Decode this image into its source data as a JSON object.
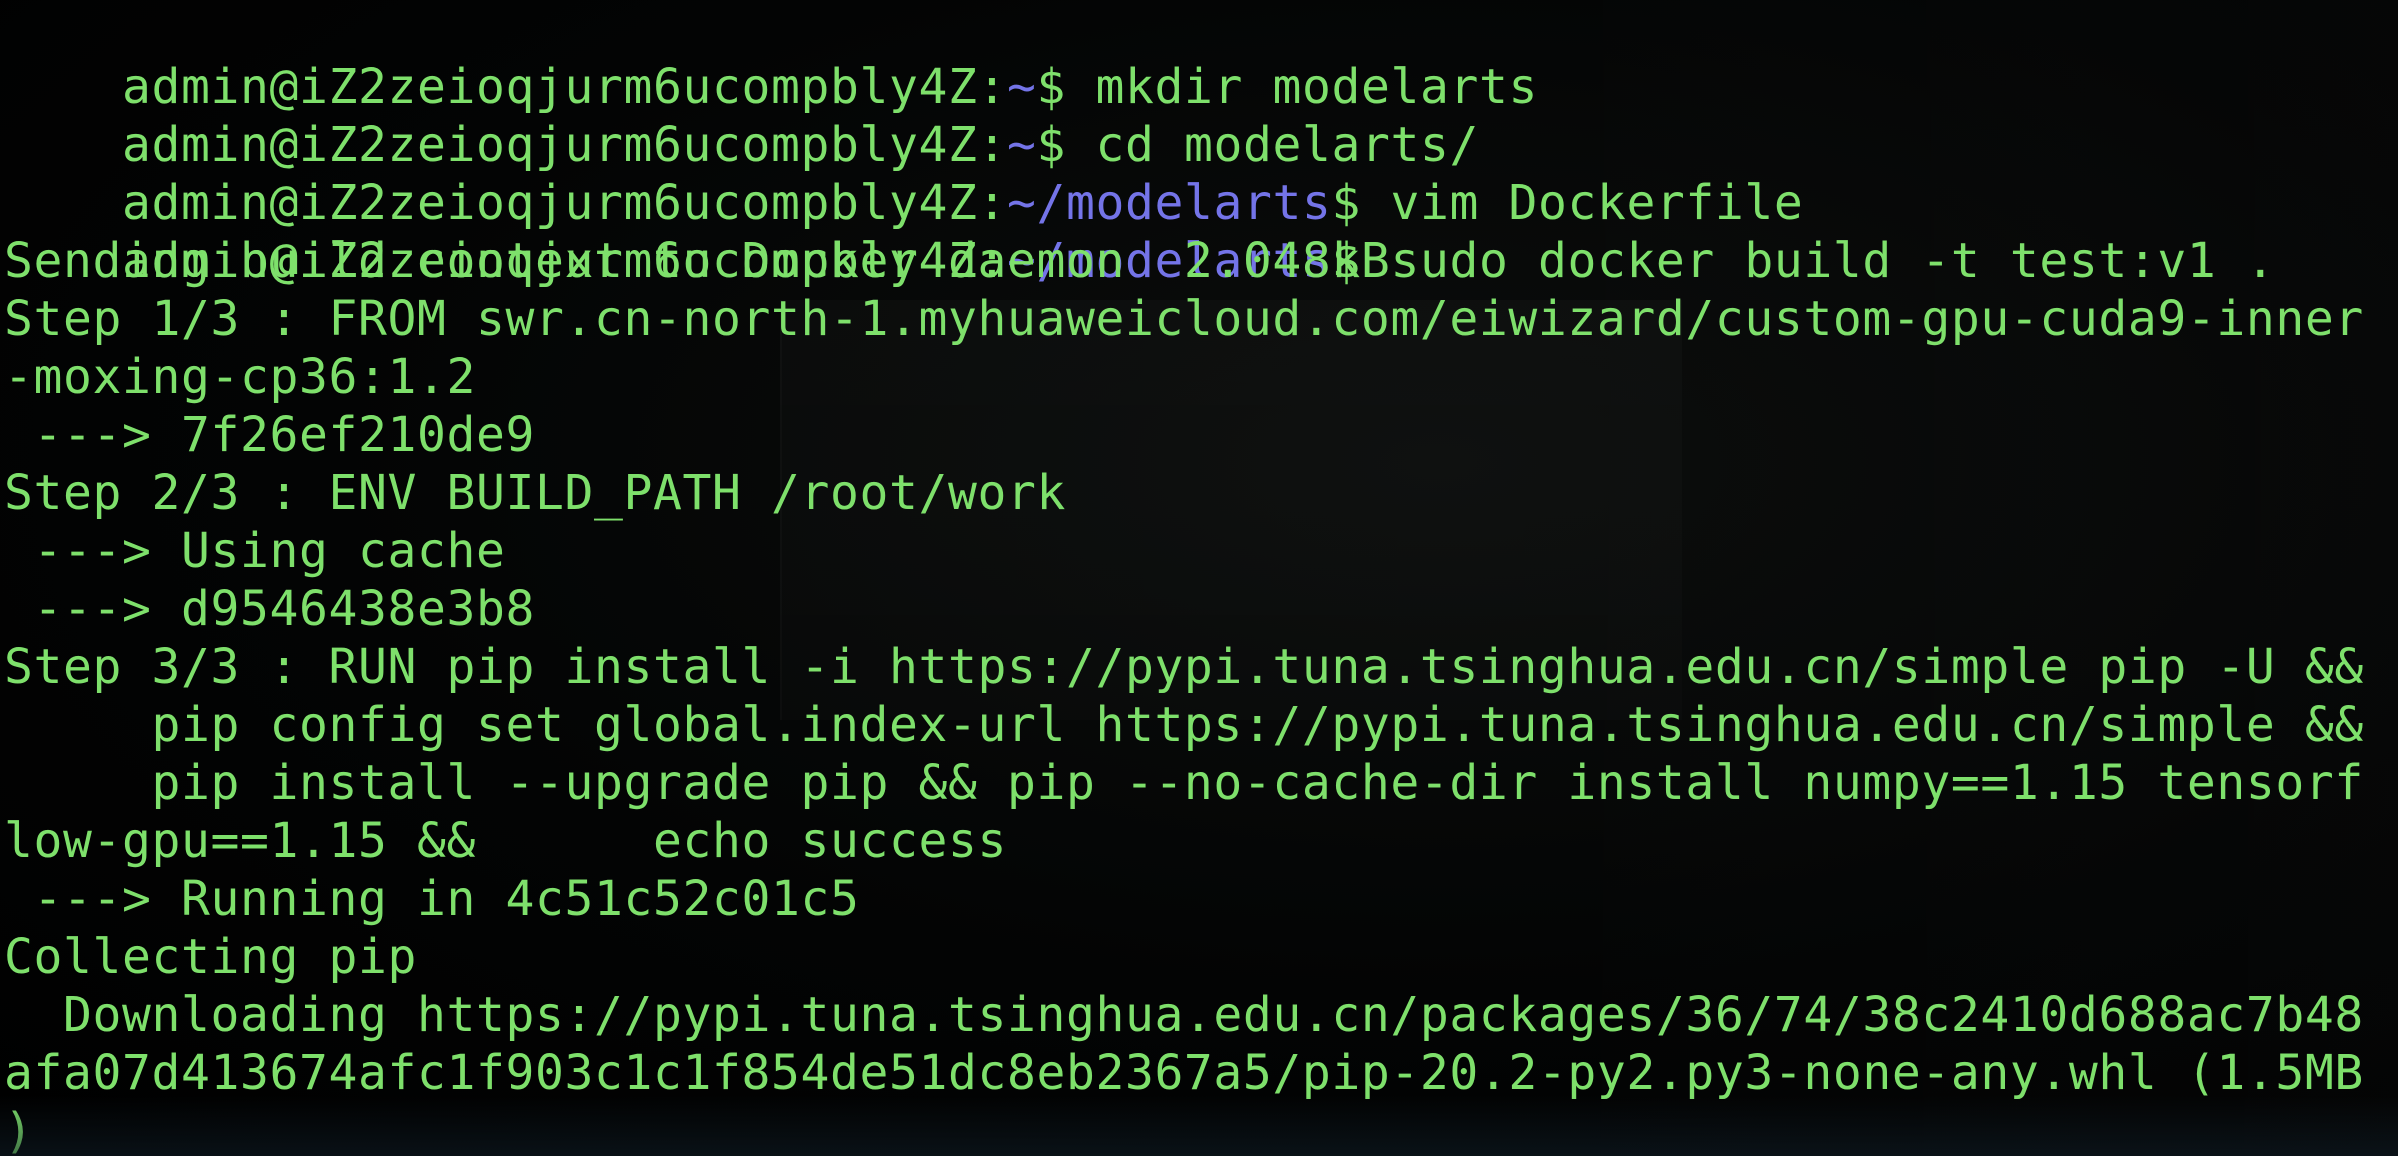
{
  "terminal": {
    "prompt_user_host": "admin@iZ2zeioqjurm6ucompbly4Z",
    "prompt_sep": ":",
    "prompt_dollar": "$",
    "colors": {
      "text": "#7ee06b",
      "path": "#7474e8",
      "background": "#000000"
    },
    "prompts": [
      {
        "path": "~",
        "command": " mkdir modelarts"
      },
      {
        "path": "~",
        "command": " cd modelarts/"
      },
      {
        "path": "~/modelarts",
        "command": " vim Dockerfile"
      },
      {
        "path": "~/modelarts",
        "command": " sudo docker build -t test:v1 ."
      }
    ],
    "output": [
      "Sending build context to Docker daemon  2.048kB",
      "Step 1/3 : FROM swr.cn-north-1.myhuaweicloud.com/eiwizard/custom-gpu-cuda9-inner",
      "-moxing-cp36:1.2",
      " ---> 7f26ef210de9",
      "Step 2/3 : ENV BUILD_PATH /root/work",
      " ---> Using cache",
      " ---> d9546438e3b8",
      "Step 3/3 : RUN pip install -i https://pypi.tuna.tsinghua.edu.cn/simple pip -U &&",
      "     pip config set global.index-url https://pypi.tuna.tsinghua.edu.cn/simple &&",
      "     pip install --upgrade pip && pip --no-cache-dir install numpy==1.15 tensorf",
      "low-gpu==1.15 &&      echo success",
      " ---> Running in 4c51c52c01c5",
      "Collecting pip",
      "  Downloading https://pypi.tuna.tsinghua.edu.cn/packages/36/74/38c2410d688ac7b48",
      "afa07d413674afc1f903c1c1f854de51dc8eb2367a5/pip-20.2-py2.py3-none-any.whl (1.5MB",
      ")"
    ]
  }
}
